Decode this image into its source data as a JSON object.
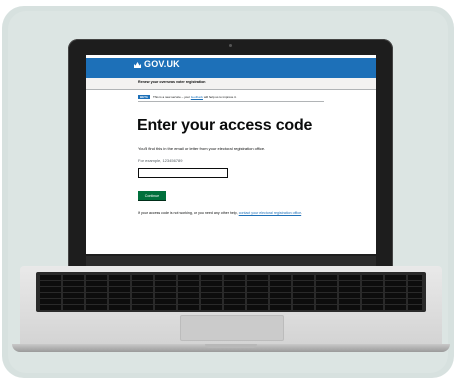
{
  "header": {
    "logo_text": "GOV.UK"
  },
  "service": {
    "name": "Renew your overseas voter registration"
  },
  "phase_banner": {
    "tag": "BETA",
    "text_before": "This is a new service – your ",
    "link": "feedback",
    "text_after": " will help us to improve it."
  },
  "main": {
    "heading": "Enter your access code",
    "hint": "You'll find this in the email or letter from your electoral registration office.",
    "example": "For example, 123456789",
    "code_input": {
      "value": ""
    },
    "continue_label": "Continue",
    "help_before": "If your access code is not working, or you need any other help, ",
    "help_link": "contact your electoral registration office",
    "help_after": "."
  }
}
